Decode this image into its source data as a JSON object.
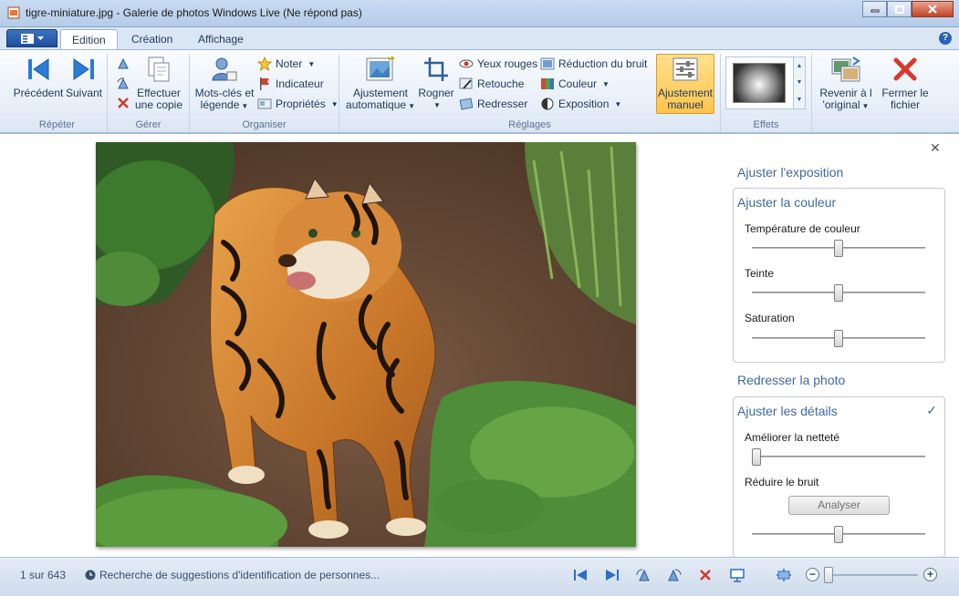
{
  "window": {
    "title": "tigre-miniature.jpg - Galerie de photos Windows Live (Ne répond pas)"
  },
  "tabs": [
    {
      "label": "Edition",
      "active": true
    },
    {
      "label": "Création",
      "active": false
    },
    {
      "label": "Affichage",
      "active": false
    }
  ],
  "ribbon": {
    "groups": {
      "repeter": "Répéter",
      "gerer": "Gérer",
      "organiser": "Organiser",
      "reglages": "Réglages",
      "effets": "Effets"
    },
    "precedent": "Précédent",
    "suivant": "Suivant",
    "copie_line1": "Effectuer",
    "copie_line2": "une copie",
    "motscles_line1": "Mots-clés et",
    "motscles_line2": "légende",
    "noter": "Noter",
    "indicateur": "Indicateur",
    "proprietes": "Propriétés",
    "ajustauto_line1": "Ajustement",
    "ajustauto_line2": "automatique",
    "rogner": "Rogner",
    "yeux_rouges": "Yeux rouges",
    "retouche": "Retouche",
    "redresser": "Redresser",
    "reduction_bruit": "Réduction du bruit",
    "couleur": "Couleur",
    "exposition": "Exposition",
    "ajustmanuel_line1": "Ajustement",
    "ajustmanuel_line2": "manuel",
    "revenir_line1": "Revenir à l",
    "revenir_line2": "'original",
    "fermer_line1": "Fermer le",
    "fermer_line2": "fichier"
  },
  "panel": {
    "ajuster_exposition": "Ajuster l'exposition",
    "ajuster_couleur": "Ajuster la couleur",
    "temperature": "Température de couleur",
    "teinte": "Teinte",
    "saturation": "Saturation",
    "redresser_photo": "Redresser la photo",
    "ajuster_details": "Ajuster les détails",
    "netete": "Améliorer la netteté",
    "reduire_bruit": "Réduire le bruit",
    "analyser": "Analyser",
    "slider_levels": {
      "temperature": 0.5,
      "teinte": 0.5,
      "saturation": 0.5,
      "netete": 0.0,
      "bruit": 0.5
    }
  },
  "status": {
    "count": "1 sur 643",
    "message": "Recherche de suggestions d'identification de personnes..."
  },
  "colors": {
    "accent": "#3e6a9e",
    "manual_highlight": "#ffc44d",
    "close_red": "#c6422a"
  }
}
